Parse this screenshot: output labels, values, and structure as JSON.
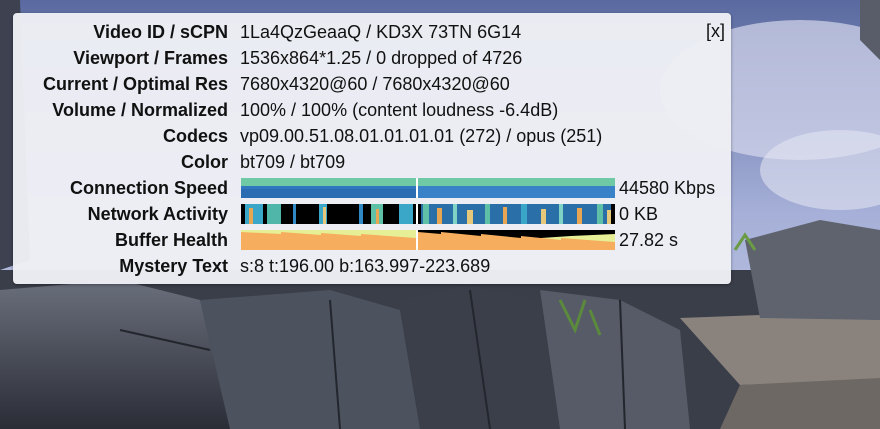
{
  "close_label": "[x]",
  "rows": [
    {
      "label": "Video ID / sCPN",
      "value": "1La4QzGeaaQ / KD3X 73TN 6G14"
    },
    {
      "label": "Viewport / Frames",
      "value": "1536x864*1.25 / 0 dropped of 4726"
    },
    {
      "label": "Current / Optimal Res",
      "value": "7680x4320@60 / 7680x4320@60"
    },
    {
      "label": "Volume / Normalized",
      "value": "100% / 100% (content loudness -6.4dB)"
    },
    {
      "label": "Codecs",
      "value": "vp09.00.51.08.01.01.01.01 (272) / opus (251)"
    },
    {
      "label": "Color",
      "value": "bt709 / bt709"
    },
    {
      "label": "Connection Speed",
      "value": "44580 Kbps"
    },
    {
      "label": "Network Activity",
      "value": "0 KB"
    },
    {
      "label": "Buffer Health",
      "value": "27.82 s"
    },
    {
      "label": "Mystery Text",
      "value": "s:8 t:196.00 b:163.997-223.689"
    }
  ],
  "colors": {
    "connection_top": "#6fc9a4",
    "connection_bottom": "#2f77bf",
    "network_bg": "#000000",
    "buffer_light": "#e7ef96",
    "buffer_orange": "#f6ad5d"
  }
}
